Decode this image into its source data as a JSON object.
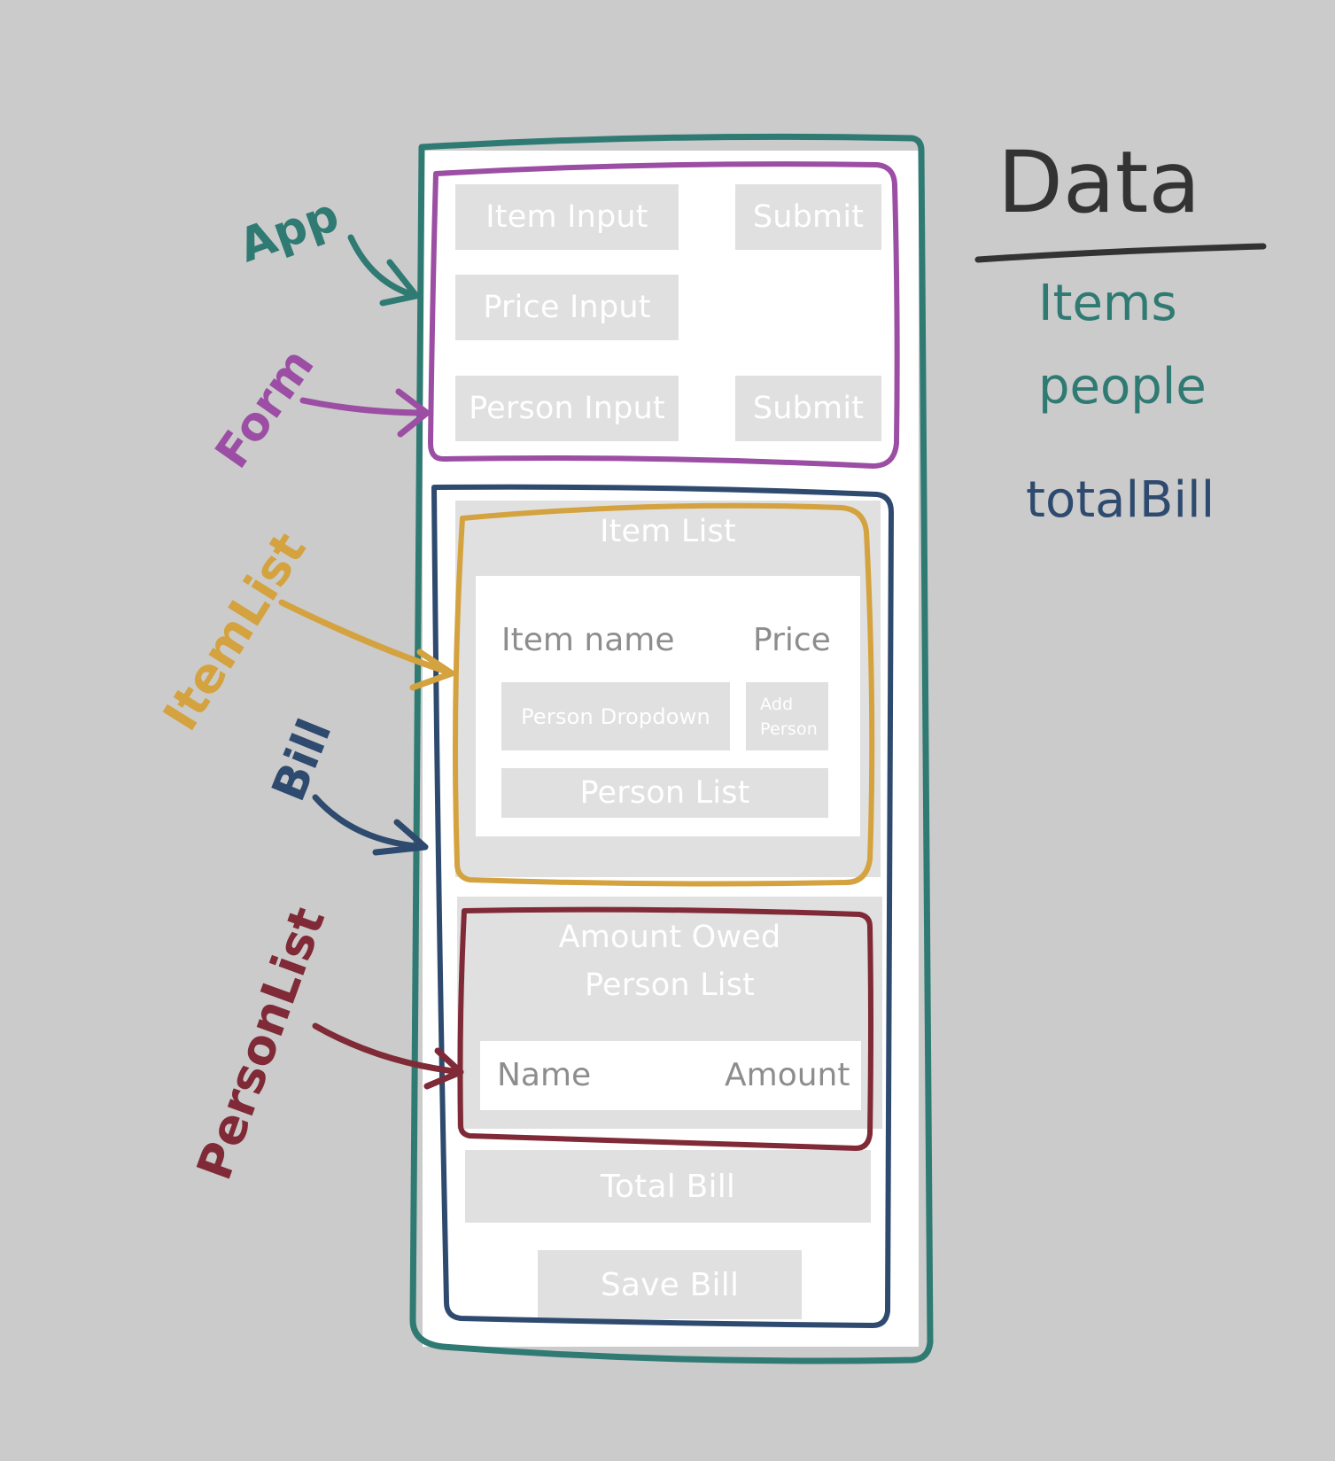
{
  "form": {
    "item_input": "Item Input",
    "price_input": "Price Input",
    "person_input": "Person Input",
    "submit_item": "Submit",
    "submit_person": "Submit"
  },
  "item_list": {
    "title": "Item List",
    "item_name": "Item name",
    "price": "Price",
    "person_dropdown": "Person Dropdown",
    "add_person_line1": "Add",
    "add_person_line2": "Person",
    "person_list": "Person List"
  },
  "amount_owed": {
    "title_line1": "Amount Owed",
    "title_line2": "Person List",
    "name": "Name",
    "amount": "Amount"
  },
  "bill": {
    "total_bill": "Total Bill",
    "save_bill": "Save Bill"
  },
  "annotations": {
    "app": "App",
    "form": "Form",
    "item_list": "ItemList",
    "bill": "Bill",
    "person_list": "PersonList"
  },
  "data_legend": {
    "heading": "Data",
    "items": [
      "Items",
      "people",
      "totalBill"
    ]
  },
  "colors": {
    "app": "#2f7a72",
    "form": "#9b4ea3",
    "item_list": "#d4a23e",
    "bill": "#2e4a6e",
    "person_list": "#7f2a36",
    "data_heading": "#333333",
    "background": "#cbcbcb",
    "box_fill": "#e0e0e0"
  }
}
